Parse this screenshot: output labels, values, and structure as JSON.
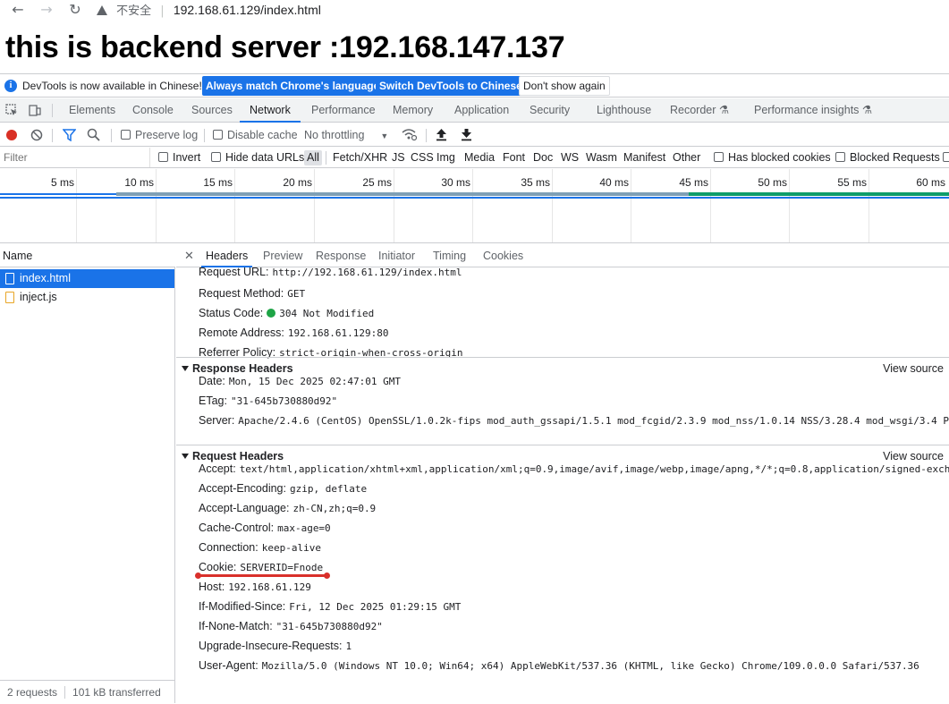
{
  "browser": {
    "insecure_label": "不安全",
    "url": "192.168.61.129/index.html"
  },
  "page": {
    "heading": "this is backend server :192.168.147.137"
  },
  "infobar": {
    "message": "DevTools is now available in Chinese!",
    "btn_match": "Always match Chrome's language",
    "btn_switch": "Switch DevTools to Chinese",
    "btn_dismiss": "Don't show again"
  },
  "tabs": [
    "Elements",
    "Console",
    "Sources",
    "Network",
    "Performance",
    "Memory",
    "Application",
    "Security",
    "Lighthouse",
    "Recorder",
    "Performance insights"
  ],
  "active_tab": "Network",
  "toolbar": {
    "preserve_log": "Preserve log",
    "disable_cache": "Disable cache",
    "throttling": "No throttling"
  },
  "filterbar": {
    "placeholder": "Filter",
    "invert": "Invert",
    "hide_data_urls": "Hide data URLs",
    "types": [
      "All",
      "Fetch/XHR",
      "JS",
      "CSS",
      "Img",
      "Media",
      "Font",
      "Doc",
      "WS",
      "Wasm",
      "Manifest",
      "Other"
    ],
    "has_blocked_cookies": "Has blocked cookies",
    "blocked_requests": "Blocked Requests"
  },
  "timeline": {
    "ticks": [
      "5 ms",
      "10 ms",
      "15 ms",
      "20 ms",
      "25 ms",
      "30 ms",
      "35 ms",
      "40 ms",
      "45 ms",
      "50 ms",
      "55 ms",
      "60 ms"
    ]
  },
  "requests": {
    "header": "Name",
    "rows": [
      {
        "name": "index.html",
        "type": "document",
        "selected": true
      },
      {
        "name": "inject.js",
        "type": "script",
        "selected": false
      }
    ],
    "footer_count": "2 requests",
    "footer_transferred": "101 kB transferred"
  },
  "detail_tabs": [
    "Headers",
    "Preview",
    "Response",
    "Initiator",
    "Timing",
    "Cookies"
  ],
  "general": [
    {
      "name": "Request URL:",
      "value": "http://192.168.61.129/index.html"
    },
    {
      "name": "Request Method:",
      "value": "GET"
    },
    {
      "name": "Status Code:",
      "value": "304 Not Modified"
    },
    {
      "name": "Remote Address:",
      "value": "192.168.61.129:80"
    },
    {
      "name": "Referrer Policy:",
      "value": "strict-origin-when-cross-origin"
    }
  ],
  "response_headers": {
    "title": "Response Headers",
    "view_source": "View source",
    "items": [
      {
        "name": "Date:",
        "value": "Mon, 15 Dec 2025 02:47:01 GMT"
      },
      {
        "name": "ETag:",
        "value": "\"31-645b730880d92\""
      },
      {
        "name": "Server:",
        "value": "Apache/2.4.6 (CentOS) OpenSSL/1.0.2k-fips mod_auth_gssapi/1.5.1 mod_fcgid/2.3.9 mod_nss/1.0.14 NSS/3.28.4 mod_wsgi/3.4 P"
      }
    ]
  },
  "request_headers": {
    "title": "Request Headers",
    "view_source": "View source",
    "items": [
      {
        "name": "Accept:",
        "value": "text/html,application/xhtml+xml,application/xml;q=0.9,image/avif,image/webp,image/apng,*/*;q=0.8,application/signed-exch"
      },
      {
        "name": "Accept-Encoding:",
        "value": "gzip, deflate"
      },
      {
        "name": "Accept-Language:",
        "value": "zh-CN,zh;q=0.9"
      },
      {
        "name": "Cache-Control:",
        "value": "max-age=0"
      },
      {
        "name": "Connection:",
        "value": "keep-alive"
      },
      {
        "name": "Cookie:",
        "value": "SERVERID=Fnode"
      },
      {
        "name": "Host:",
        "value": "192.168.61.129"
      },
      {
        "name": "If-Modified-Since:",
        "value": "Fri, 12 Dec 2025 01:29:15 GMT"
      },
      {
        "name": "If-None-Match:",
        "value": "\"31-645b730880d92\""
      },
      {
        "name": "Upgrade-Insecure-Requests:",
        "value": "1"
      },
      {
        "name": "User-Agent:",
        "value": "Mozilla/5.0 (Windows NT 10.0; Win64; x64) AppleWebKit/537.36 (KHTML, like Gecko) Chrome/109.0.0.0 Safari/537.36"
      }
    ]
  },
  "colors": {
    "accent": "#1a73e8",
    "status_ok": "#1ea446",
    "annotation": "#d9302b"
  }
}
